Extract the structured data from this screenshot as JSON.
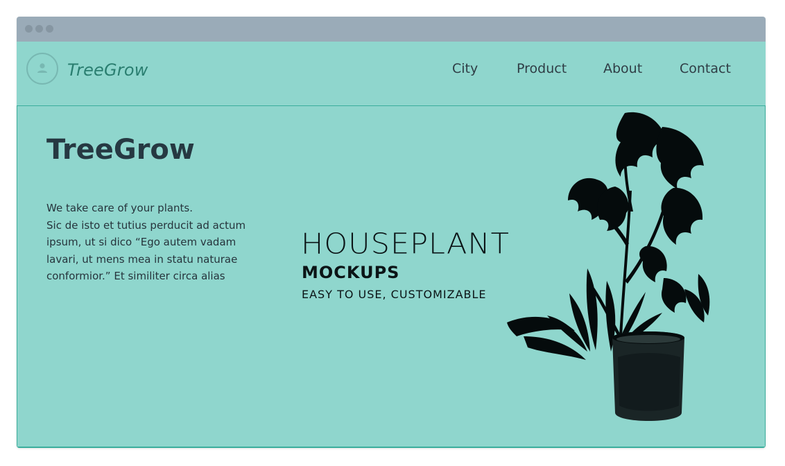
{
  "window": {
    "dots": [
      "window-dot",
      "window-dot",
      "window-dot"
    ]
  },
  "header": {
    "brand": "TreeGrow",
    "nav": [
      "City",
      "Product",
      "About",
      "Contact"
    ]
  },
  "hero": {
    "title": "TreeGrow",
    "description_lines": [
      "We take care of your plants.",
      "Sic de isto et tutius perducit ad actum",
      "ipsum, ut si dico “Ego autem vadam",
      "lavari, ut mens mea in statu naturae",
      "conformior.” Et similiter circa alias"
    ]
  },
  "mockup": {
    "title": "HOUSEPLANT",
    "subtitle": "MOCKUPS",
    "tagline": "EASY TO USE, CUSTOMIZABLE"
  },
  "icons": {
    "avatar": "user-icon",
    "illustration": "houseplant-illustration"
  },
  "colors": {
    "background": "#8fd6cd",
    "titlebar": "#9aabb8",
    "brand": "#2a7e70",
    "text": "#263942",
    "border": "#3aae9c"
  }
}
